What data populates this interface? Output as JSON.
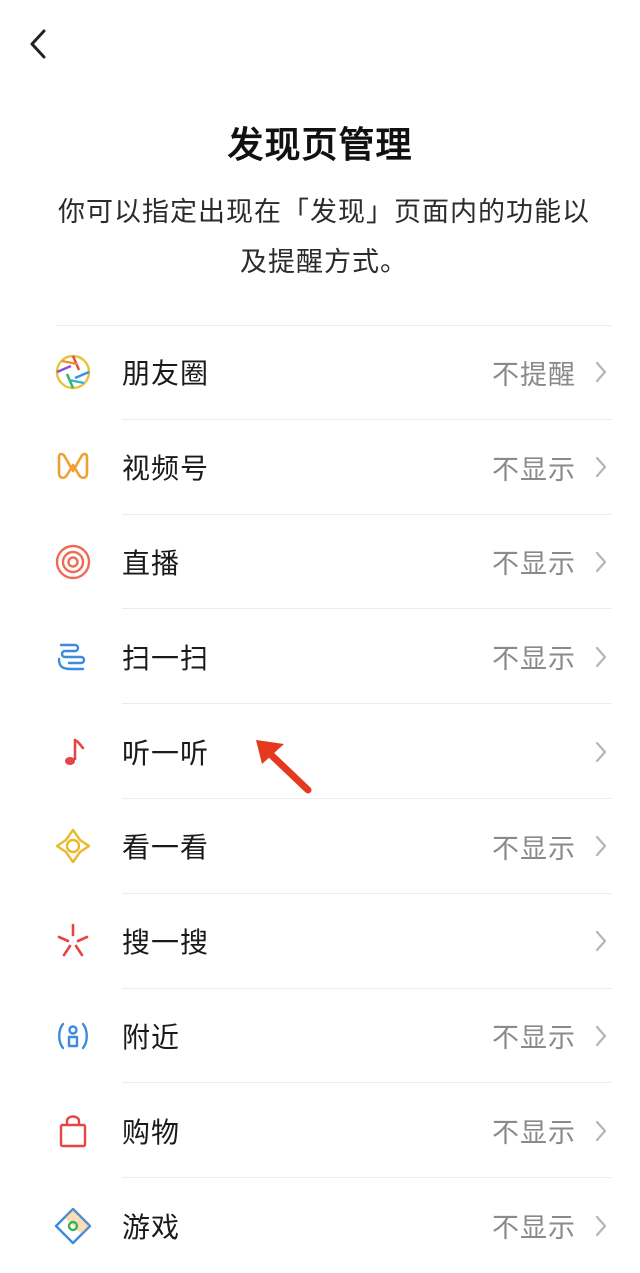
{
  "header": {
    "title": "发现页管理",
    "description": "你可以指定出现在「发现」页面内的功能以及提醒方式。"
  },
  "items": [
    {
      "label": "朋友圈",
      "status": "不提醒",
      "icon": "moments-icon"
    },
    {
      "label": "视频号",
      "status": "不显示",
      "icon": "channels-icon"
    },
    {
      "label": "直播",
      "status": "不显示",
      "icon": "live-icon"
    },
    {
      "label": "扫一扫",
      "status": "不显示",
      "icon": "scan-icon"
    },
    {
      "label": "听一听",
      "status": "",
      "icon": "listen-icon"
    },
    {
      "label": "看一看",
      "status": "不显示",
      "icon": "top-stories-icon"
    },
    {
      "label": "搜一搜",
      "status": "",
      "icon": "search-icon"
    },
    {
      "label": "附近",
      "status": "不显示",
      "icon": "nearby-icon"
    },
    {
      "label": "购物",
      "status": "不显示",
      "icon": "shopping-icon"
    },
    {
      "label": "游戏",
      "status": "不显示",
      "icon": "games-icon"
    }
  ],
  "colors": {
    "annotation_arrow": "#e5391f",
    "chevron": "#b5b5b5",
    "status_text": "#8a8a8a"
  }
}
